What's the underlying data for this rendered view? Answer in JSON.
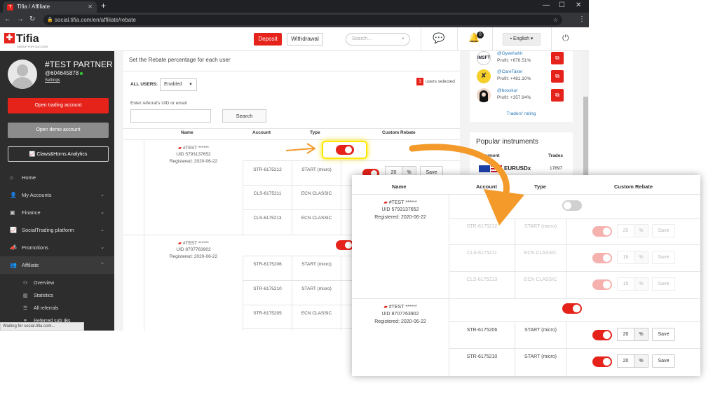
{
  "browser": {
    "tab_title": "Tifia / Affiliate",
    "tab_favicon": "T",
    "url": "social.tifia.com/en/affiliate/rebate",
    "status_text": "Waiting for social.tifia.com..."
  },
  "header": {
    "logo_text": "Tifia",
    "logo_sub": "GROUP FOR SUCCESS",
    "deposit_label": "Deposit",
    "withdrawal_label": "Withdrawal",
    "search_placeholder": "Search...",
    "notif_count": "0",
    "language": "English"
  },
  "profile": {
    "name": "#TEST PARTNER",
    "id": "@604645878",
    "settings_label": "Settings"
  },
  "sidebar": {
    "open_trading": "Open trading account",
    "open_demo": "Open demo account",
    "analytics": "Claws&Horns Analytics",
    "items": [
      {
        "label": "Home",
        "icon": "home-icon"
      },
      {
        "label": "My Accounts",
        "icon": "user-icon"
      },
      {
        "label": "Finance",
        "icon": "money-icon"
      },
      {
        "label": "SocialTrading platform",
        "icon": "chart-icon"
      },
      {
        "label": "Promotions",
        "icon": "megaphone-icon"
      },
      {
        "label": "Affiliate",
        "icon": "users-icon"
      }
    ],
    "sub_items": [
      {
        "label": "Overview"
      },
      {
        "label": "Statistics"
      },
      {
        "label": "All referrals"
      },
      {
        "label": "Referred sub IBs"
      }
    ]
  },
  "main": {
    "intro": "Set the Rebate percentage for each user",
    "all_users_label": "ALL USERS:",
    "all_users_value": "Enabled",
    "selected_count": "3",
    "selected_label": "users selected",
    "uid_label": "Enter referral's UID or email",
    "search_label": "Search",
    "columns": [
      "Name",
      "Account",
      "Type",
      "Custom Rebate"
    ],
    "users": [
      {
        "name": "#TEST ******",
        "uid": "UID 5793137652",
        "registered": "Registered: 2020-06-22",
        "accounts": [
          {
            "account": "STR-6175212",
            "type": "START (micro)",
            "rebate": "20"
          },
          {
            "account": "CLS-6175211",
            "type": "ECN CLASSIC",
            "rebate": ""
          },
          {
            "account": "CLS-6175213",
            "type": "ECN CLASSIC",
            "rebate": ""
          }
        ]
      },
      {
        "name": "#TEST ******",
        "uid": "UID 8707763902",
        "registered": "Registered: 2020-06-22",
        "accounts": [
          {
            "account": "STR-6175206",
            "type": "START (micro)",
            "rebate": ""
          },
          {
            "account": "STR-6175210",
            "type": "START (micro)",
            "rebate": ""
          },
          {
            "account": "STR-6175205",
            "type": "ECN CLASSIC",
            "rebate": ""
          }
        ]
      }
    ],
    "pct": "%",
    "save": "Save"
  },
  "traders": {
    "items": [
      {
        "name": "@Oyeehahh",
        "profit": "Profit: +676.51%"
      },
      {
        "name": "@CareTaker",
        "profit": "Profit: +481.10%"
      },
      {
        "name": "@bosskur",
        "profit": "Profit: +357.94%"
      }
    ],
    "rating_link": "Traders' rating",
    "popular_title": "Popular instruments",
    "instrument_col": "Instrument",
    "trades_col": "Trades",
    "instrument": "EURUSDx",
    "trades": "17897"
  },
  "zoom": {
    "columns": [
      "Name",
      "Account",
      "Type",
      "Custom Rebate"
    ],
    "users": [
      {
        "name": "#TEST ******",
        "uid": "UID 5793137652",
        "registered": "Registered: 2020-06-22",
        "accounts": [
          {
            "account": "STR-6175212",
            "type": "START (micro)",
            "rebate": "20"
          },
          {
            "account": "CLS-6175211",
            "type": "ECN CLASSIC",
            "rebate": "16"
          },
          {
            "account": "CLS-6175213",
            "type": "ECN CLASSIC",
            "rebate": "15"
          }
        ]
      },
      {
        "name": "#TEST ******",
        "uid": "UID 8707763902",
        "registered": "Registered: 2020-06-22",
        "accounts": [
          {
            "account": "STR-6175206",
            "type": "START (micro)",
            "rebate": "20"
          },
          {
            "account": "STR-6175210",
            "type": "START (micro)",
            "rebate": "20"
          }
        ]
      }
    ]
  },
  "colors": {
    "brand_red": "#e5231b",
    "sidebar_bg": "#2d2d2d",
    "highlight": "#ffe600",
    "arrow": "#f39a2a"
  }
}
